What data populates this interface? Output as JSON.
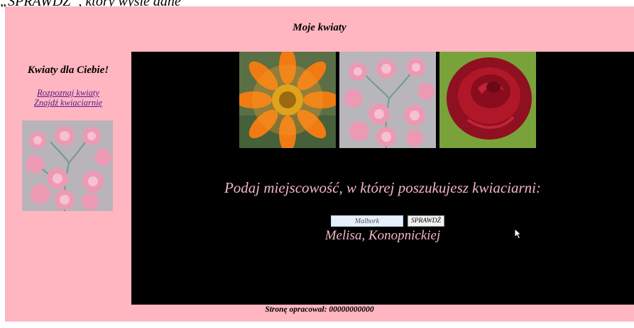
{
  "top_caption": "„SPRAWDŹ”, który wyśle dane",
  "header": {
    "title": "Moje kwiaty"
  },
  "sidebar": {
    "heading": "Kwiaty dla Ciebie!",
    "links": [
      "Rozpoznaj kwiaty",
      "Znajdź kwiaciarnię"
    ]
  },
  "main": {
    "prompt": "Podaj miejscowość, w której poszukujesz kwiaciarni:",
    "city_input_value": "Malbork",
    "check_button_label": "SPRAWDŹ",
    "result": "Melisa, Konopnickiej"
  },
  "footer": {
    "text": "Stronę opracował: 00000000000"
  },
  "colors": {
    "page_bg": "#ffb6c1",
    "main_bg": "#000000",
    "accent_text": "#f3b6c8"
  },
  "icons": [
    "gerbera-image",
    "carnation-image",
    "rose-image",
    "carnation-thumbnail-image",
    "mouse-cursor-icon"
  ]
}
